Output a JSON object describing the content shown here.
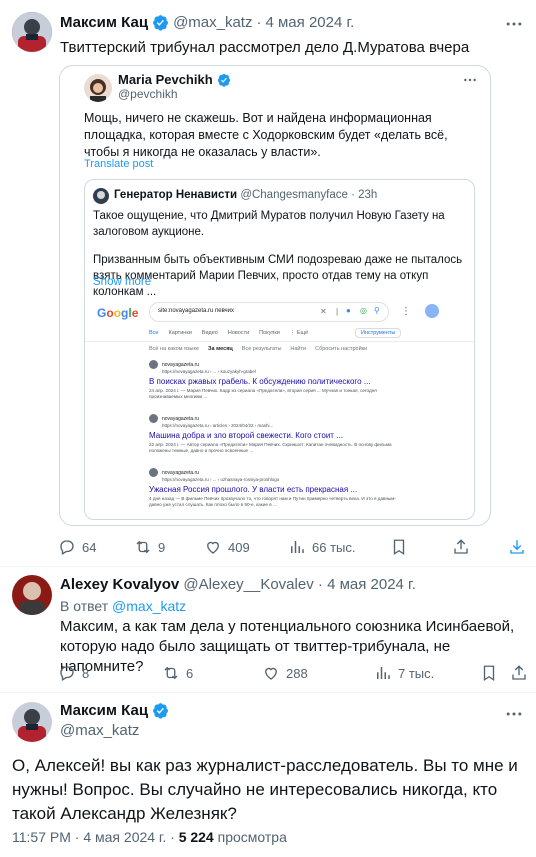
{
  "tweet1": {
    "author_name": "Максим Кац",
    "handle": "@max_katz",
    "date": "4 мая 2024 г.",
    "text": "Твиттерский трибунал рассмотрел дело Д.Муратова вчера",
    "stats": {
      "replies": "64",
      "retweets": "9",
      "likes": "409",
      "views": "66 тыс."
    }
  },
  "quote": {
    "author_name": "Maria Pevchikh",
    "handle": "@pevchikh",
    "text": "Мощь, ничего не скажешь. Вот и найдена информационная площадка, которая вместе с Ходорковским будет «делать всё, чтобы я никогда не оказалась у власти».",
    "translate": "Translate post"
  },
  "inner_quote": {
    "author_name": "Генератор Ненависти",
    "handle": "@Changesmanyface",
    "time": "23h",
    "text1": "Такое ощущение, что Дмитрий Муратов получил Новую Газету на залоговом аукционе.",
    "text2": "Призванным быть объективным СМИ подозреваю даже не пыталось взять комментарий Марии Певчих, просто отдав тему на откуп колонкам ...",
    "show_more": "Show more"
  },
  "google": {
    "logo": "Google",
    "query": "site:novayagazeta.ru певчих",
    "tabs": [
      "Все",
      "Картинки",
      "Видео",
      "Новости",
      "Покупки",
      "⋮ Ещё"
    ],
    "tools": "Инструменты",
    "filters": [
      "Всё на каком языке",
      "За месяц",
      "Все результаты",
      "Найти",
      "Сбросить настройки"
    ],
    "results": [
      {
        "site": "novayagazeta.ru",
        "url": "https://novayagazeta.ru › ... › kouzyakyh-grabel",
        "title": "В поисках ржавых грабель. К обсуждению политического ...",
        "snippet": "24 апр. 2024 г. — Мария Певчих. Кадр из сериала «Предатели», вторая серия ... Мучная и тонкая, сегодня произнаваемых многими ..."
      },
      {
        "site": "novayagazeta.ru",
        "url": "https://novayagazeta.ru › articles › 2024/04/22 › mashi...",
        "title": "Машина добра и зло второй свежести. Кого стоит ...",
        "snippet": "22 апр. 2024 г. — Автор сериала «Предатели» Мария Певчих. Скриншот: Капитан очевидность. В основу фильма положены темные, давно и прочно освоенные ..."
      },
      {
        "site": "novayagazeta.ru",
        "url": "https://novayagazeta.ru › ... › uzhasnaya-rossiya-proshlogo",
        "title": "Ужасная Россия прошлого. У власти есть прекрасная ...",
        "snippet": "4 дня назад — В фильме Певчих прозвучало то, что говорят нам и Путин примерно четверть века. И это я давным-давно уже устал слушать. Как плохо было в 90-е, какие в ..."
      }
    ]
  },
  "reply": {
    "author_name": "Alexey Kovalyov",
    "handle": "@Alexey__Kovalev",
    "date": "4 мая 2024 г.",
    "in_reply_prefix": "В ответ",
    "in_reply_handle": "@max_katz",
    "text": "Максим, а как там дела у потенциального союзника Исинбаевой, которую надо было защищать от твиттер-трибунала, не напомните?",
    "stats": {
      "replies": "8",
      "retweets": "6",
      "likes": "288",
      "views": "7 тыс."
    }
  },
  "tweet3": {
    "author_name": "Максим Кац",
    "handle": "@max_katz",
    "text": "О, Алексей! вы как раз журналист-расследователь. Вы то мне и нужны! Вопрос. Вы случайно не интересовались никогда, кто такой Александр Железняк?",
    "time": "11:57 PM",
    "date": "4 мая 2024 г.",
    "views_count": "5 224",
    "views_label": "просмотра"
  },
  "sep": "·",
  "colors": {
    "accent": "#1d9bf0",
    "muted": "#536471",
    "border": "#cfd9de",
    "google_link": "#1a0dab"
  },
  "icons": [
    "more-icon",
    "verified-icon",
    "reply-icon",
    "retweet-icon",
    "like-icon",
    "views-icon",
    "bookmark-icon",
    "share-icon",
    "download-icon",
    "search-icon",
    "mic-icon",
    "camera-icon",
    "close-icon",
    "apps-icon"
  ]
}
